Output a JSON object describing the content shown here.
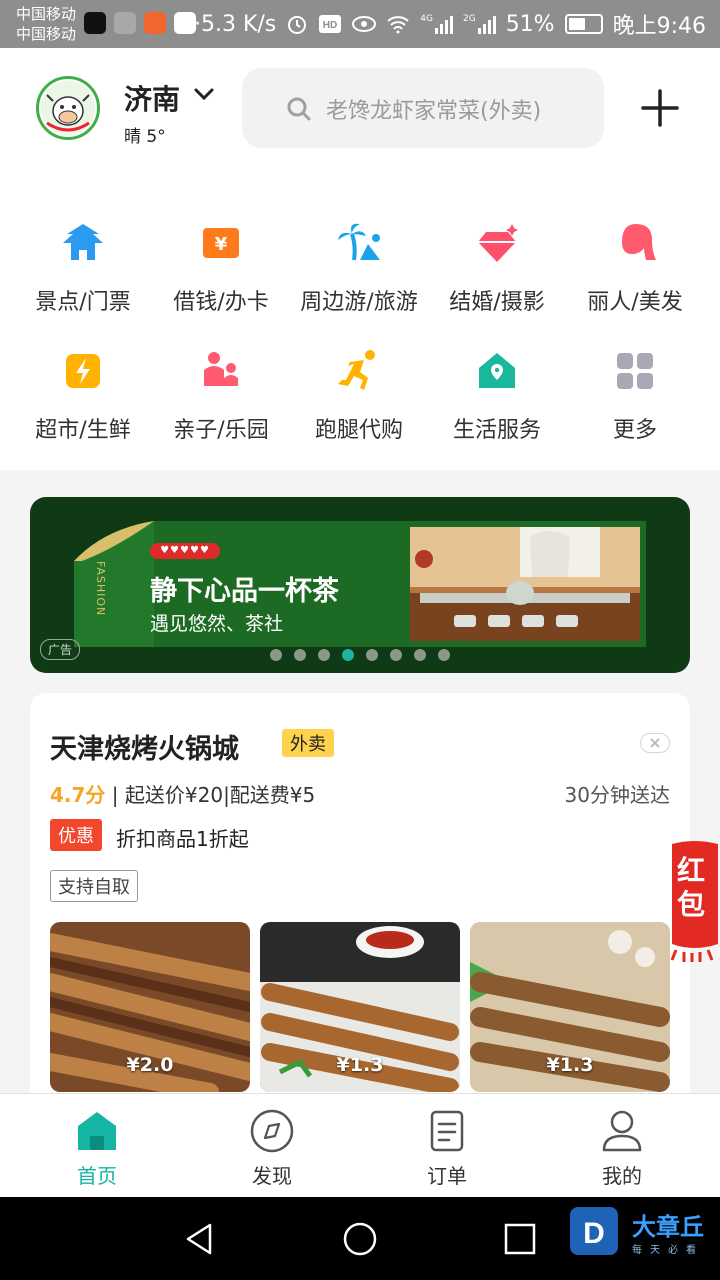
{
  "status_bar": {
    "carrier_1": "中国移动",
    "carrier_2": "中国移动",
    "speed": "··5.3 K/s",
    "net_4g": "4G",
    "net_2g": "2G",
    "battery": "51%",
    "time": "晚上9:46",
    "colors": {
      "background": "#8e8e8e"
    }
  },
  "header": {
    "city": "济南",
    "weather": "晴 5°",
    "search_placeholder": "老馋龙虾家常菜(外卖)",
    "plus_icon": "plus-icon",
    "location_chevron_icon": "chevron-down-icon"
  },
  "categories": [
    {
      "label": "景点/门票",
      "icon": "pagoda-icon",
      "color": "#2a9bf0"
    },
    {
      "label": "借钱/办卡",
      "icon": "yuan-card-icon",
      "color": "#ff7a1a"
    },
    {
      "label": "周边游/旅游",
      "icon": "palm-tree-icon",
      "color": "#1aa3e8"
    },
    {
      "label": "结婚/摄影",
      "icon": "diamond-icon",
      "color": "#ff4f6a"
    },
    {
      "label": "丽人/美发",
      "icon": "woman-hair-icon",
      "color": "#ff5a6e"
    },
    {
      "label": "超市/生鲜",
      "icon": "lightning-icon",
      "color": "#ffb300"
    },
    {
      "label": "亲子/乐园",
      "icon": "parent-child-icon",
      "color": "#ff5a6e"
    },
    {
      "label": "跑腿代购",
      "icon": "runner-icon",
      "color": "#ffb300"
    },
    {
      "label": "生活服务",
      "icon": "house-location-icon",
      "color": "#19b89c"
    },
    {
      "label": "更多",
      "icon": "grid-more-icon",
      "color": "#a9a9b5"
    }
  ],
  "banner": {
    "hearts": "♥♥♥♥♥",
    "side_text": "FASHION",
    "title": "静下心品一杯茶",
    "subtitle": "遇见悠然、茶社",
    "ad_tag": "广告",
    "active_dot": 4,
    "dot_count": 8,
    "colors": {
      "background": "#0f3a15",
      "active_dot": "#1db5a2"
    }
  },
  "store": {
    "name": "天津烧烤火锅城",
    "badge": "外卖",
    "rating": "4.7分",
    "delivery_info": "| 起送价¥20|配送费¥5",
    "delivery_time": "30分钟送达",
    "promo_tag": "优惠",
    "promo_text": "折扣商品1折起",
    "pickup": "支持自取",
    "foods": [
      {
        "price": "¥2.0"
      },
      {
        "price": "¥1.3"
      },
      {
        "price": "¥1.3"
      }
    ],
    "colors": {
      "rating": "#f5a623",
      "badge": "#ffd34d",
      "promo": "#f2472c"
    }
  },
  "red_envelope": {
    "text": "红包"
  },
  "tabbar": {
    "tabs": [
      {
        "label": "首页",
        "icon": "home-icon",
        "active": true
      },
      {
        "label": "发现",
        "icon": "compass-icon",
        "active": false
      },
      {
        "label": "订单",
        "icon": "order-list-icon",
        "active": false
      },
      {
        "label": "我的",
        "icon": "profile-icon",
        "active": false
      }
    ],
    "colors": {
      "active": "#14b5a5"
    }
  },
  "watermark": {
    "title": "大章丘",
    "subtitle": "每天必看"
  }
}
